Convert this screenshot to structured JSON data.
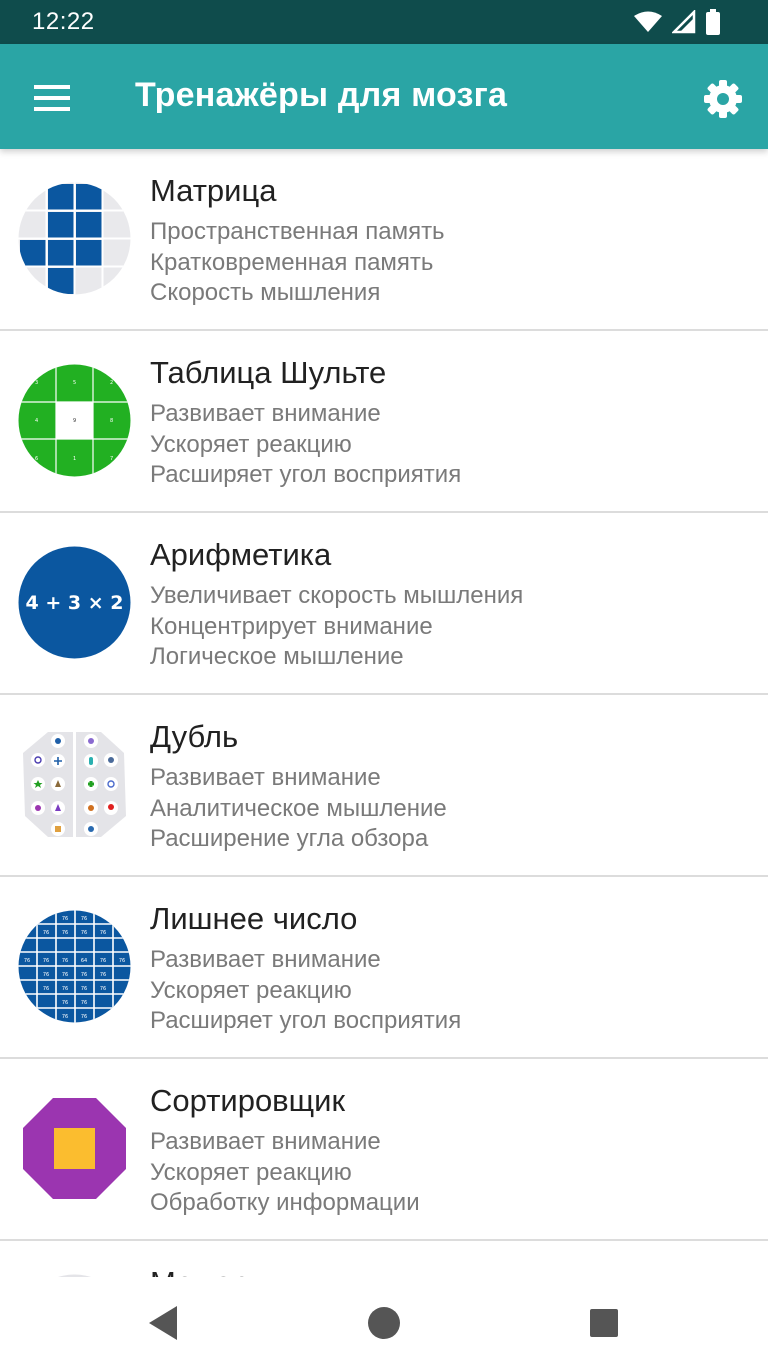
{
  "status_bar": {
    "time": "12:22"
  },
  "app_bar": {
    "title": "Тренажёры для мозга",
    "menu_icon": "hamburger-menu-icon",
    "settings_icon": "gear-icon"
  },
  "trainers": [
    {
      "title": "Матрица",
      "icon": "matrix-icon",
      "lines": [
        "Пространственная память",
        "Кратковременная память",
        "Скорость мышления"
      ]
    },
    {
      "title": "Таблица Шульте",
      "icon": "schulte-table-icon",
      "lines": [
        "Развивает внимание",
        "Ускоряет реакцию",
        "Расширяет угол восприятия"
      ]
    },
    {
      "title": "Арифметика",
      "icon": "arithmetic-icon",
      "icon_text": "4 + 3 × 2",
      "lines": [
        "Увеличивает скорость мышления",
        "Концентрирует внимание",
        "Логическое мышление"
      ]
    },
    {
      "title": "Дубль",
      "icon": "double-icon",
      "lines": [
        "Развивает внимание",
        "Аналитическое мышление",
        "Расширение угла обзора"
      ]
    },
    {
      "title": "Лишнее число",
      "icon": "extra-number-icon",
      "lines": [
        "Развивает внимание",
        "Ускоряет реакцию",
        "Расширяет угол восприятия"
      ]
    },
    {
      "title": "Сортировщик",
      "icon": "sorter-icon",
      "lines": [
        "Развивает внимание",
        "Ускоряет реакцию",
        "Обработку информации"
      ]
    },
    {
      "title": "Мемори",
      "icon": "memory-icon",
      "lines": []
    }
  ],
  "nav_bar": {
    "back_icon": "back-triangle-icon",
    "home_icon": "home-circle-icon",
    "recents_icon": "recents-square-icon"
  },
  "colors": {
    "status_bar": "#0f4c4c",
    "app_bar": "#2aa5a5",
    "blue": "#0b57a0",
    "green": "#22b022",
    "purple": "#9b35b0",
    "amber": "#fbbd2f"
  }
}
